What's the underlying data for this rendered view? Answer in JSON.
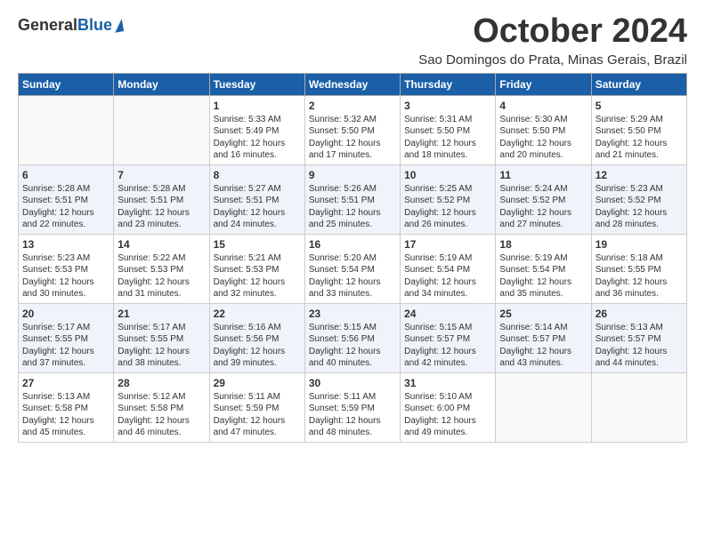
{
  "header": {
    "logo_general": "General",
    "logo_blue": "Blue",
    "month_title": "October 2024",
    "location": "Sao Domingos do Prata, Minas Gerais, Brazil"
  },
  "columns": [
    "Sunday",
    "Monday",
    "Tuesday",
    "Wednesday",
    "Thursday",
    "Friday",
    "Saturday"
  ],
  "weeks": [
    {
      "days": [
        {
          "num": "",
          "info": ""
        },
        {
          "num": "",
          "info": ""
        },
        {
          "num": "1",
          "info": "Sunrise: 5:33 AM\nSunset: 5:49 PM\nDaylight: 12 hours and 16 minutes."
        },
        {
          "num": "2",
          "info": "Sunrise: 5:32 AM\nSunset: 5:50 PM\nDaylight: 12 hours and 17 minutes."
        },
        {
          "num": "3",
          "info": "Sunrise: 5:31 AM\nSunset: 5:50 PM\nDaylight: 12 hours and 18 minutes."
        },
        {
          "num": "4",
          "info": "Sunrise: 5:30 AM\nSunset: 5:50 PM\nDaylight: 12 hours and 20 minutes."
        },
        {
          "num": "5",
          "info": "Sunrise: 5:29 AM\nSunset: 5:50 PM\nDaylight: 12 hours and 21 minutes."
        }
      ]
    },
    {
      "days": [
        {
          "num": "6",
          "info": "Sunrise: 5:28 AM\nSunset: 5:51 PM\nDaylight: 12 hours and 22 minutes."
        },
        {
          "num": "7",
          "info": "Sunrise: 5:28 AM\nSunset: 5:51 PM\nDaylight: 12 hours and 23 minutes."
        },
        {
          "num": "8",
          "info": "Sunrise: 5:27 AM\nSunset: 5:51 PM\nDaylight: 12 hours and 24 minutes."
        },
        {
          "num": "9",
          "info": "Sunrise: 5:26 AM\nSunset: 5:51 PM\nDaylight: 12 hours and 25 minutes."
        },
        {
          "num": "10",
          "info": "Sunrise: 5:25 AM\nSunset: 5:52 PM\nDaylight: 12 hours and 26 minutes."
        },
        {
          "num": "11",
          "info": "Sunrise: 5:24 AM\nSunset: 5:52 PM\nDaylight: 12 hours and 27 minutes."
        },
        {
          "num": "12",
          "info": "Sunrise: 5:23 AM\nSunset: 5:52 PM\nDaylight: 12 hours and 28 minutes."
        }
      ]
    },
    {
      "days": [
        {
          "num": "13",
          "info": "Sunrise: 5:23 AM\nSunset: 5:53 PM\nDaylight: 12 hours and 30 minutes."
        },
        {
          "num": "14",
          "info": "Sunrise: 5:22 AM\nSunset: 5:53 PM\nDaylight: 12 hours and 31 minutes."
        },
        {
          "num": "15",
          "info": "Sunrise: 5:21 AM\nSunset: 5:53 PM\nDaylight: 12 hours and 32 minutes."
        },
        {
          "num": "16",
          "info": "Sunrise: 5:20 AM\nSunset: 5:54 PM\nDaylight: 12 hours and 33 minutes."
        },
        {
          "num": "17",
          "info": "Sunrise: 5:19 AM\nSunset: 5:54 PM\nDaylight: 12 hours and 34 minutes."
        },
        {
          "num": "18",
          "info": "Sunrise: 5:19 AM\nSunset: 5:54 PM\nDaylight: 12 hours and 35 minutes."
        },
        {
          "num": "19",
          "info": "Sunrise: 5:18 AM\nSunset: 5:55 PM\nDaylight: 12 hours and 36 minutes."
        }
      ]
    },
    {
      "days": [
        {
          "num": "20",
          "info": "Sunrise: 5:17 AM\nSunset: 5:55 PM\nDaylight: 12 hours and 37 minutes."
        },
        {
          "num": "21",
          "info": "Sunrise: 5:17 AM\nSunset: 5:55 PM\nDaylight: 12 hours and 38 minutes."
        },
        {
          "num": "22",
          "info": "Sunrise: 5:16 AM\nSunset: 5:56 PM\nDaylight: 12 hours and 39 minutes."
        },
        {
          "num": "23",
          "info": "Sunrise: 5:15 AM\nSunset: 5:56 PM\nDaylight: 12 hours and 40 minutes."
        },
        {
          "num": "24",
          "info": "Sunrise: 5:15 AM\nSunset: 5:57 PM\nDaylight: 12 hours and 42 minutes."
        },
        {
          "num": "25",
          "info": "Sunrise: 5:14 AM\nSunset: 5:57 PM\nDaylight: 12 hours and 43 minutes."
        },
        {
          "num": "26",
          "info": "Sunrise: 5:13 AM\nSunset: 5:57 PM\nDaylight: 12 hours and 44 minutes."
        }
      ]
    },
    {
      "days": [
        {
          "num": "27",
          "info": "Sunrise: 5:13 AM\nSunset: 5:58 PM\nDaylight: 12 hours and 45 minutes."
        },
        {
          "num": "28",
          "info": "Sunrise: 5:12 AM\nSunset: 5:58 PM\nDaylight: 12 hours and 46 minutes."
        },
        {
          "num": "29",
          "info": "Sunrise: 5:11 AM\nSunset: 5:59 PM\nDaylight: 12 hours and 47 minutes."
        },
        {
          "num": "30",
          "info": "Sunrise: 5:11 AM\nSunset: 5:59 PM\nDaylight: 12 hours and 48 minutes."
        },
        {
          "num": "31",
          "info": "Sunrise: 5:10 AM\nSunset: 6:00 PM\nDaylight: 12 hours and 49 minutes."
        },
        {
          "num": "",
          "info": ""
        },
        {
          "num": "",
          "info": ""
        }
      ]
    }
  ]
}
